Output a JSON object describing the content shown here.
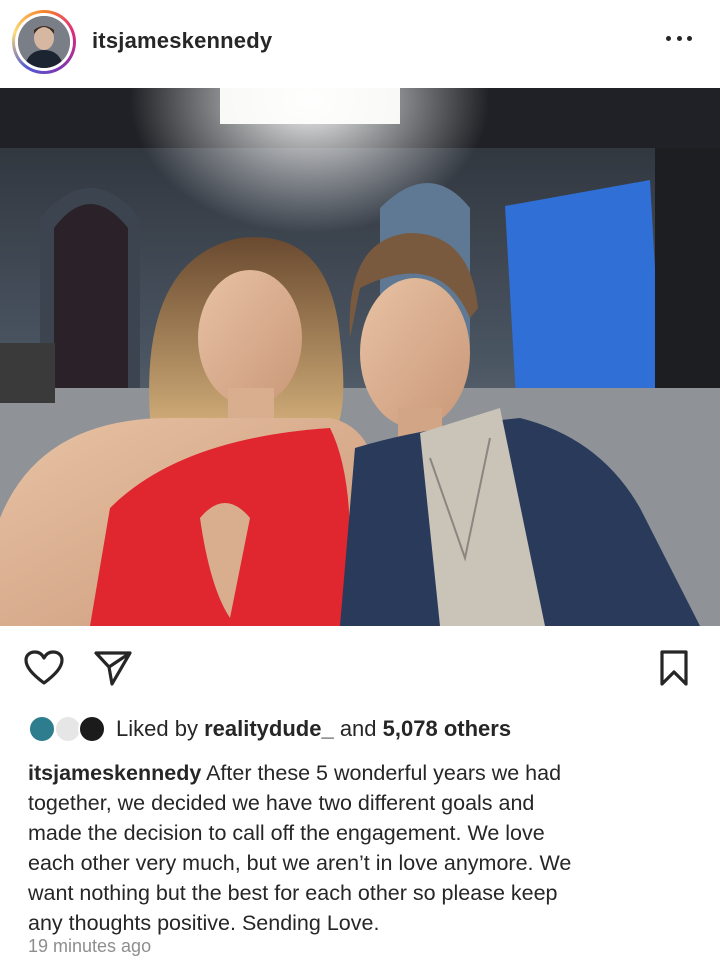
{
  "header": {
    "username": "itsjameskennedy",
    "avatar_icon": "profile-avatar",
    "more_icon": "more-options-icon"
  },
  "photo": {
    "colors": {
      "background_wall": "#3d4550",
      "blue_backdrop": "#2f6fd6",
      "red_dress": "#e0262f",
      "blazer": "#2a3a5a",
      "tshirt": "#c9c3b8"
    }
  },
  "actions": {
    "like_icon": "heart-icon",
    "share_icon": "send-icon",
    "save_icon": "bookmark-icon"
  },
  "likes": {
    "prefix": "Liked by",
    "liked_by_user": "realitydude_",
    "connector": "and",
    "others": "5,078 others"
  },
  "caption": {
    "username": "itsjameskennedy",
    "lines": [
      "After these 5 wonderful years we had",
      "together, we decided we have two different goals and",
      "made the decision to call off the engagement. We love",
      "each other very much, but we aren’t in love anymore. We",
      "want nothing but the best for each other so please keep",
      "any thoughts positive. Sending Love."
    ]
  },
  "timestamp": "19 minutes ago"
}
